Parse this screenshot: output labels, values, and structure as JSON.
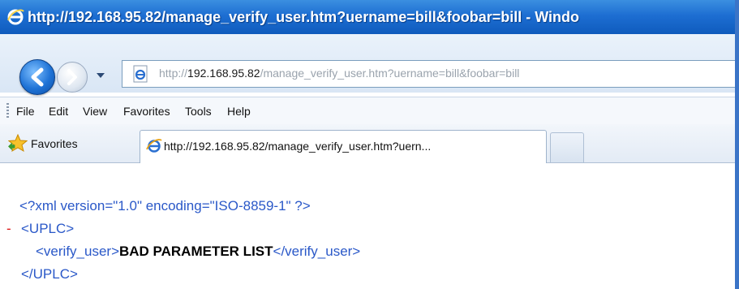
{
  "window": {
    "title": "http://192.168.95.82/manage_verify_user.htm?uername=bill&foobar=bill - Windo"
  },
  "address_bar": {
    "scheme": "http://",
    "host": "192.168.95.82",
    "path": "/manage_verify_user.htm?uername=bill&foobar=bill"
  },
  "menu": {
    "items": [
      "File",
      "Edit",
      "View",
      "Favorites",
      "Tools",
      "Help"
    ]
  },
  "favorites_bar": {
    "label": "Favorites"
  },
  "tabs": [
    {
      "label": "http://192.168.95.82/manage_verify_user.htm?uern..."
    }
  ],
  "content": {
    "xml_decl": "<?xml version=\"1.0\" encoding=\"ISO-8859-1\" ?>",
    "collapse_marker": "-",
    "root_open": "<UPLC>",
    "child_open": "<verify_user>",
    "child_value": "BAD PARAMETER LIST",
    "child_close": "</verify_user>",
    "root_close": "</UPLC>"
  },
  "colors": {
    "titlebar": "#1d6ed2",
    "xml_markup": "#2a58c8",
    "collapse_marker": "#dd1111"
  },
  "icons": {
    "title": "ie-logo-icon",
    "back": "back-arrow-icon",
    "forward": "forward-arrow-icon",
    "page": "ie-page-icon",
    "favorites": "star-icon",
    "tab": "ie-logo-icon"
  }
}
